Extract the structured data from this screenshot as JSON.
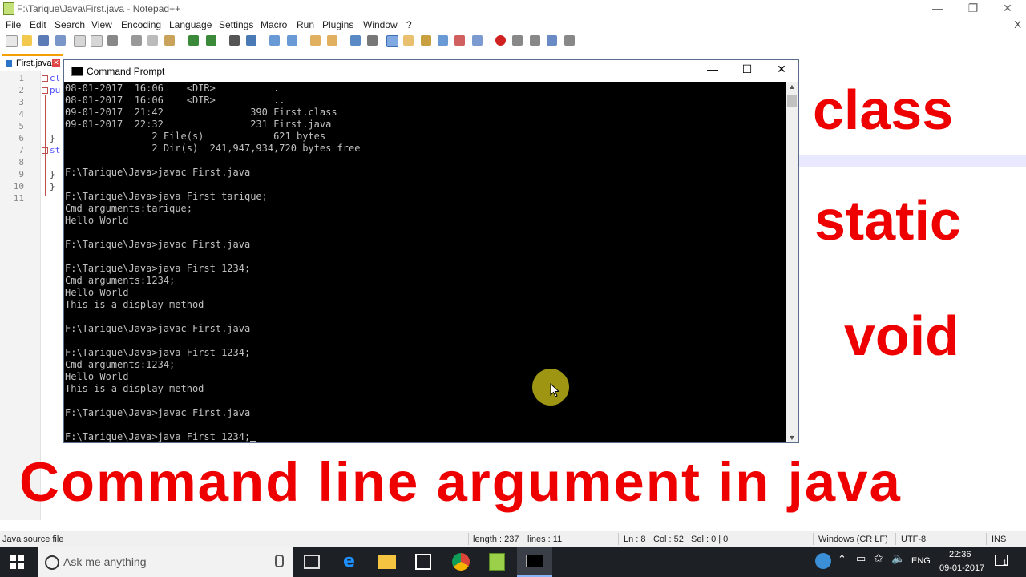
{
  "notepad": {
    "title": "F:\\Tarique\\Java\\First.java - Notepad++",
    "menu": [
      "File",
      "Edit",
      "Search",
      "View",
      "Encoding",
      "Language",
      "Settings",
      "Macro",
      "Run",
      "Plugins",
      "Window",
      "?"
    ],
    "menu_close": "X",
    "tab_label": "First.java",
    "line_numbers": [
      "1",
      "2",
      "3",
      "4",
      "5",
      "6",
      "7",
      "8",
      "9",
      "10",
      "11"
    ],
    "code_fragments": [
      "cl",
      "pu",
      "st"
    ],
    "status": {
      "file_type": "Java source file",
      "length": "length : 237",
      "lines": "lines : 11",
      "ln": "Ln : 8",
      "col": "Col : 52",
      "sel": "Sel : 0 | 0",
      "eol": "Windows (CR LF)",
      "encoding": "UTF-8",
      "mode": "INS"
    }
  },
  "overlay": {
    "word1": "class",
    "word2": "static",
    "word3": "void",
    "title": "Command line argument in java",
    "color": "#ee0000"
  },
  "cmd": {
    "title": "Command Prompt",
    "lines": [
      "08-01-2017  16:06    <DIR>          .",
      "08-01-2017  16:06    <DIR>          ..",
      "09-01-2017  21:42               390 First.class",
      "09-01-2017  22:32               231 First.java",
      "               2 File(s)            621 bytes",
      "               2 Dir(s)  241,947,934,720 bytes free",
      "",
      "F:\\Tarique\\Java>javac First.java",
      "",
      "F:\\Tarique\\Java>java First tarique;",
      "Cmd arguments:tarique;",
      "Hello World",
      "",
      "F:\\Tarique\\Java>javac First.java",
      "",
      "F:\\Tarique\\Java>java First 1234;",
      "Cmd arguments:1234;",
      "Hello World",
      "This is a display method",
      "",
      "F:\\Tarique\\Java>javac First.java",
      "",
      "F:\\Tarique\\Java>java First 1234;",
      "Cmd arguments:1234;",
      "Hello World",
      "This is a display method",
      "",
      "F:\\Tarique\\Java>javac First.java",
      "",
      "F:\\Tarique\\Java>java First 1234;"
    ]
  },
  "taskbar": {
    "search_placeholder": "Ask me anything",
    "language": "ENG",
    "time": "22:36",
    "date": "09-01-2017",
    "notifications": "1"
  }
}
